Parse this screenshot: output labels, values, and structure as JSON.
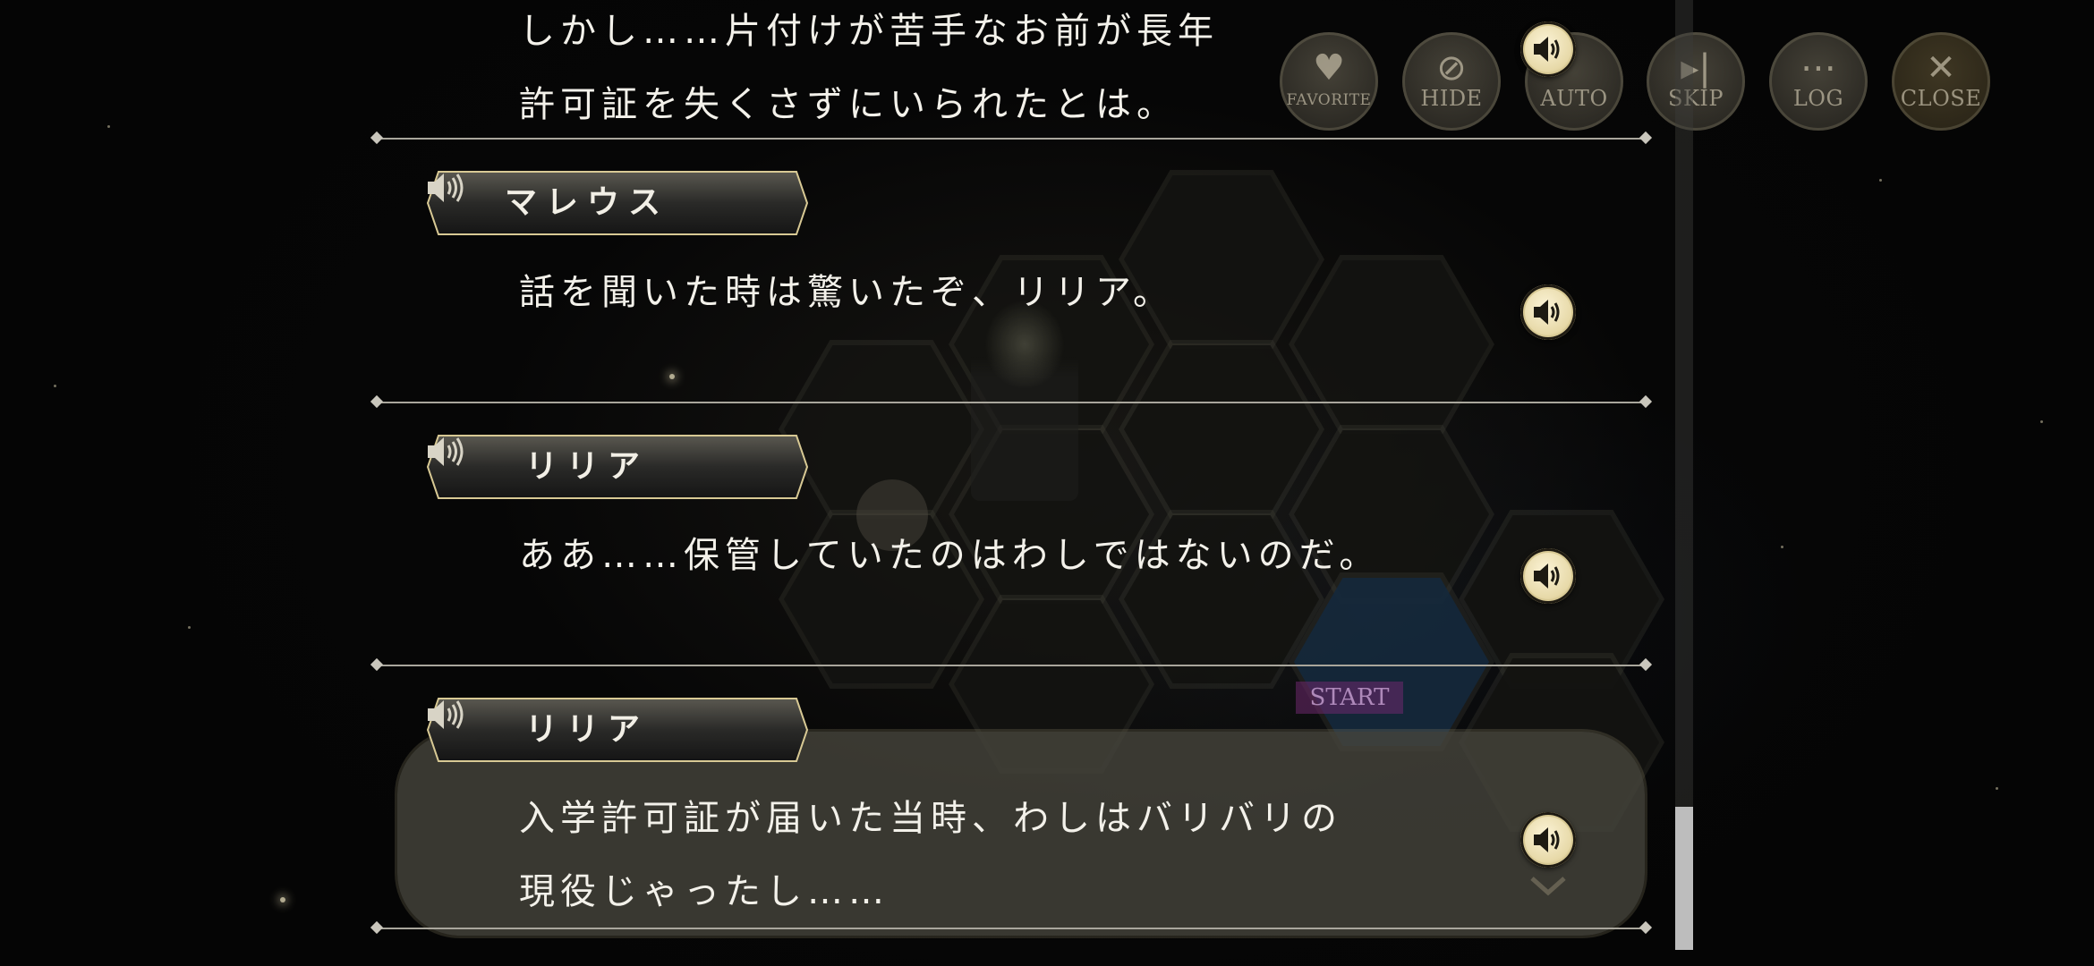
{
  "toolbar": {
    "favorite_label": "FAVORITE",
    "hide_label": "HIDE",
    "auto_label": "AUTO",
    "skip_label": "SKIP",
    "log_label": "LOG",
    "close_label": "CLOSE"
  },
  "background": {
    "start_label": "START"
  },
  "log": {
    "entries": [
      {
        "speaker": "",
        "lines": [
          "しかし……片付けが苦手なお前が長年",
          "許可証を失くさずにいられたとは。"
        ]
      },
      {
        "speaker": "マレウス",
        "lines": [
          "話を聞いた時は驚いたぞ、リリア。"
        ]
      },
      {
        "speaker": "リリア",
        "lines": [
          "ああ……保管していたのはわしではないのだ。"
        ]
      },
      {
        "speaker": "リリア",
        "lines": [
          "入学許可証が届いた当時、わしはバリバリの",
          "現役じゃったし……"
        ]
      }
    ]
  },
  "colors": {
    "accent_gold": "#e7d9a8",
    "text": "#f3f1ea",
    "divider": "#a9a69c"
  },
  "icons": {
    "voice": "speaker-icon",
    "favorite": "heart-icon",
    "hide": "eye-slash-icon",
    "skip": "skip-icon",
    "log": "chat-bubble-icon",
    "close": "close-icon"
  }
}
